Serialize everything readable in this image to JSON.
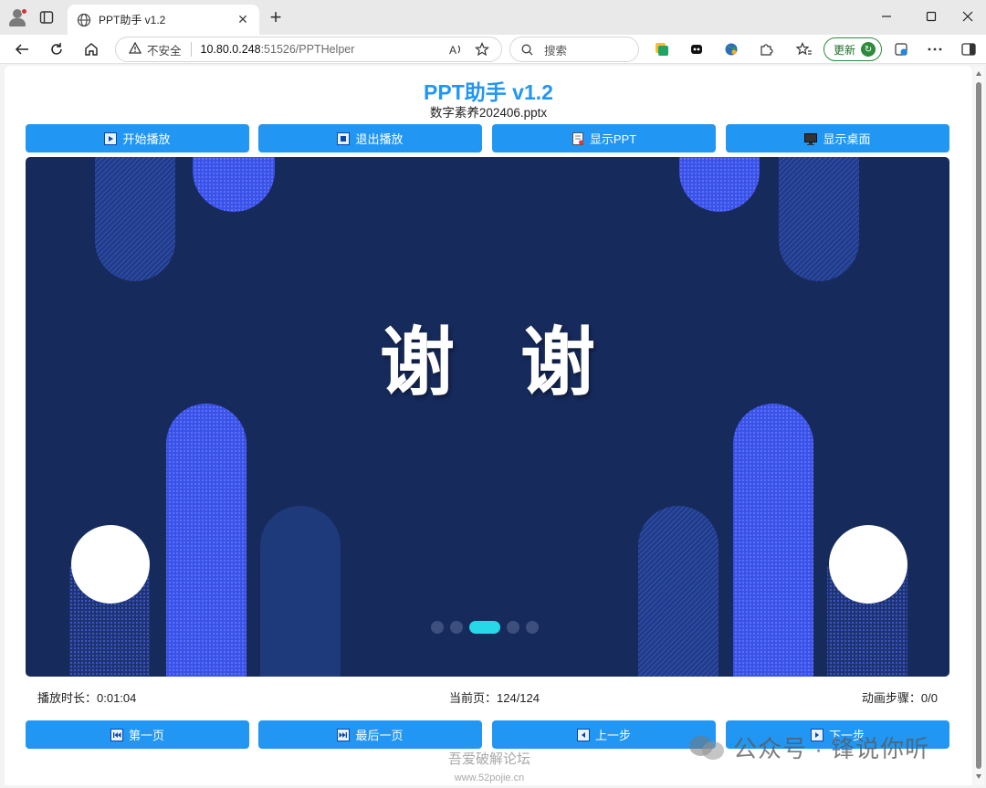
{
  "browser": {
    "tab_title": "PPT助手 v1.2",
    "new_tab_symbol": "+",
    "close_tab_symbol": "✕",
    "security_label": "不安全",
    "url_host": "10.80.0.248",
    "url_path": ":51526/PPTHelper",
    "search_placeholder": "搜索",
    "update_label": "更新",
    "icons": [
      "profile-icon",
      "tabs-icon",
      "globe-icon",
      "back-icon",
      "refresh-icon",
      "home-icon",
      "warning-icon",
      "read-aloud-icon",
      "favorite-icon",
      "search-icon",
      "extension-icon",
      "favorites-icon",
      "collections-icon",
      "more-icon",
      "sidebar-icon",
      "minimize-icon",
      "maximize-icon",
      "close-icon"
    ]
  },
  "app": {
    "title": "PPT助手 v1.2",
    "file_name": "数字素养202406.pptx",
    "top_buttons": [
      {
        "label": "开始播放",
        "icon": "play-icon"
      },
      {
        "label": "退出播放",
        "icon": "stop-icon"
      },
      {
        "label": "显示PPT",
        "icon": "ppt-icon"
      },
      {
        "label": "显示桌面",
        "icon": "desktop-icon"
      }
    ],
    "slide": {
      "text": "谢谢",
      "carousel_dots": 5,
      "active_dot": 3
    },
    "status": {
      "duration": "播放时长：0:01:04",
      "current_page": "当前页：124/124",
      "animation_step": "动画步骤：0/0"
    },
    "bottom_buttons": [
      {
        "label": "第一页",
        "icon": "first-page-icon"
      },
      {
        "label": "最后一页",
        "icon": "last-page-icon"
      },
      {
        "label": "上一步",
        "icon": "prev-step-icon"
      },
      {
        "label": "下一步",
        "icon": "next-step-icon"
      }
    ],
    "colors": {
      "accent": "#2196f3",
      "slide_bg": "#162a5c",
      "slide_shape_bright": "#4b5cf5",
      "slide_dot_active": "#27d8e8"
    }
  },
  "watermarks": {
    "wechat": "公众号 · 锋说你听",
    "forum": "吾爱破解论坛",
    "forum_site": "www.52pojie.cn"
  }
}
